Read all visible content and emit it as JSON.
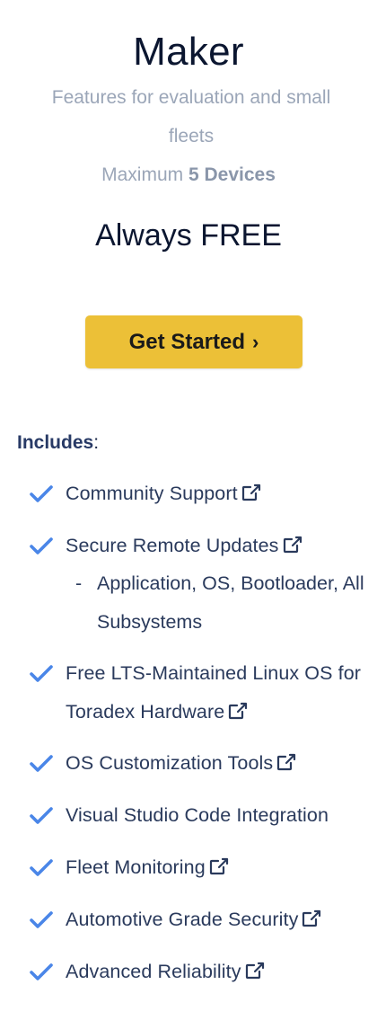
{
  "plan": {
    "name": "Maker",
    "subtitle": "Features for evaluation and small fleets",
    "max_prefix": "Maximum",
    "max_devices": "5 Devices",
    "price": "Always FREE",
    "cta_label": "Get Started",
    "cta_chevron": "›"
  },
  "includes_label": "Includes",
  "includes_colon": ":",
  "features": [
    {
      "label": "Community Support",
      "external": true
    },
    {
      "label": "Secure Remote Updates",
      "external": true
    },
    {
      "label": "Free LTS-Maintained Linux OS for Toradex Hardware",
      "external": true
    },
    {
      "label": "OS Customization Tools",
      "external": true
    },
    {
      "label": "Visual Studio Code Integration",
      "external": false
    },
    {
      "label": "Fleet Monitoring",
      "external": true
    },
    {
      "label": "Automotive Grade Security",
      "external": true
    },
    {
      "label": "Advanced Reliability",
      "external": true
    }
  ],
  "sub_features": {
    "dash": "-",
    "secure_updates_detail": "Application, OS, Bootloader, All Subsystems"
  },
  "colors": {
    "check": "#4a86e8",
    "cta_background": "#ecc037",
    "title": "#0b1630",
    "muted": "#9ba6b8",
    "body_text": "#2a3a5c"
  },
  "icons": {
    "check": "check-icon",
    "external": "external-link-icon"
  }
}
